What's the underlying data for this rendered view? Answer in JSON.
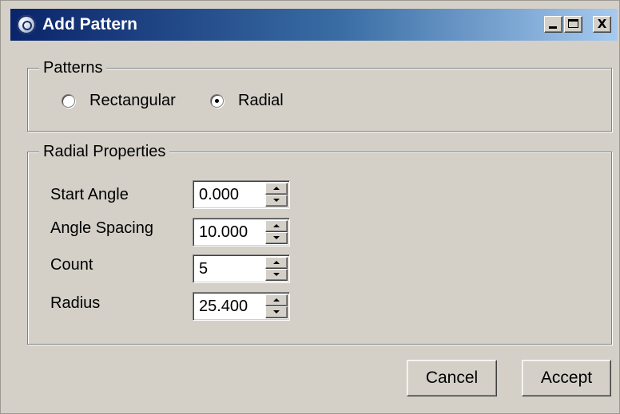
{
  "window": {
    "title": "Add Pattern",
    "app_icon": "app-logo-icon",
    "controls": {
      "minimize": "minimize-icon",
      "maximize": "maximize-icon",
      "close_label": "X"
    }
  },
  "patterns": {
    "legend": "Patterns",
    "options": [
      {
        "label": "Rectangular",
        "selected": false
      },
      {
        "label": "Radial",
        "selected": true
      }
    ]
  },
  "radial_properties": {
    "legend": "Radial Properties",
    "fields": [
      {
        "label": "Start Angle",
        "value": "0.000"
      },
      {
        "label": "Angle Spacing",
        "value": "10.000"
      },
      {
        "label": "Count",
        "value": "5"
      },
      {
        "label": "Radius",
        "value": "25.400"
      }
    ]
  },
  "buttons": {
    "cancel": "Cancel",
    "accept": "Accept"
  },
  "colors": {
    "title_bar_start": "#0a246a",
    "title_bar_end": "#a6caf0",
    "dialog_face": "#d4d0c8"
  }
}
